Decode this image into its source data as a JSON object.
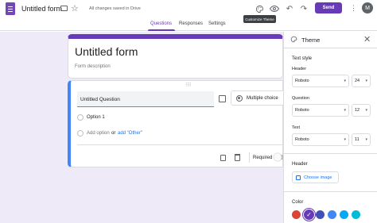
{
  "app": {
    "title": "Untitled form",
    "saved_status": "All changes saved in Drive",
    "send_label": "Send",
    "avatar_initial": "M",
    "tooltip": "Customize Theme",
    "brand_color": "#673ab7"
  },
  "tabs": [
    {
      "label": "Questions",
      "active": true
    },
    {
      "label": "Responses",
      "active": false
    },
    {
      "label": "Settings",
      "active": false
    }
  ],
  "form": {
    "title": "Untitled form",
    "description_placeholder": "Form description"
  },
  "question": {
    "title": "Untitled Question",
    "type_label": "Multiple choice",
    "option1": "Option 1",
    "add_option": "Add option",
    "or": "or",
    "add_other": "add \"Other\"",
    "required_label": "Required",
    "required": false
  },
  "theme_panel": {
    "title": "Theme",
    "text_style_label": "Text style",
    "header": {
      "label": "Header",
      "font": "Roboto",
      "size": "24"
    },
    "question": {
      "label": "Question",
      "font": "Roboto",
      "size": "12"
    },
    "text": {
      "label": "Text",
      "font": "Roboto",
      "size": "11"
    },
    "header_image_label": "Header",
    "choose_image": "Choose image",
    "color_label": "Color",
    "colors": [
      "#db4437",
      "#673ab7",
      "#3f51b5",
      "#4285f4",
      "#03a9f4",
      "#00bcd4"
    ],
    "selected_color_index": 1
  }
}
